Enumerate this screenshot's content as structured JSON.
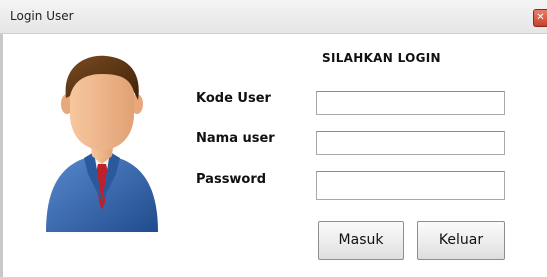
{
  "window": {
    "title": "Login User",
    "close_symbol": "✕"
  },
  "form": {
    "heading": "SILAHKAN LOGIN",
    "kode_user": {
      "label": "Kode User",
      "value": ""
    },
    "nama_user": {
      "label": "Nama user",
      "value": ""
    },
    "password": {
      "label": "Password",
      "value": ""
    }
  },
  "buttons": {
    "masuk": "Masuk",
    "keluar": "Keluar"
  },
  "avatar": {
    "icon": "user-avatar-icon",
    "colors": {
      "suit": "#2f5fa0",
      "tie": "#c0202a",
      "hair": "#5a3212",
      "skin": "#f0b88c"
    }
  }
}
